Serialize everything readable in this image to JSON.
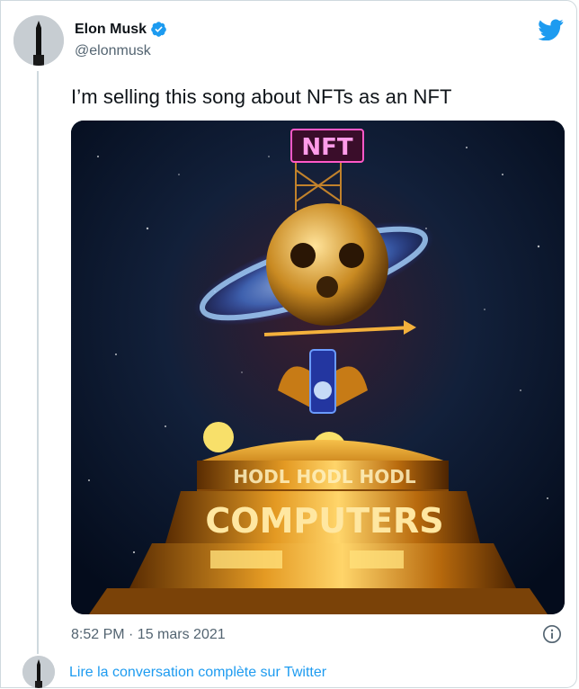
{
  "author": {
    "name": "Elon Musk",
    "handle": "@elonmusk",
    "verified": true
  },
  "tweet": {
    "text": "I’m selling this song about NFTs as an NFT",
    "timestamp": "8:52 PM · 15 mars 2021"
  },
  "media": {
    "sign_text": "NFT",
    "band_text": "HODL HODL HODL",
    "base_text": "COMPUTERS"
  },
  "footer": {
    "read_conversation": "Lire la conversation complète sur Twitter"
  },
  "colors": {
    "twitter_blue": "#1d9bf0",
    "text_primary": "#0f1419",
    "text_secondary": "#536471"
  },
  "icons": {
    "logo": "twitter-bird-icon",
    "verified": "verified-badge-icon",
    "info": "info-icon"
  }
}
